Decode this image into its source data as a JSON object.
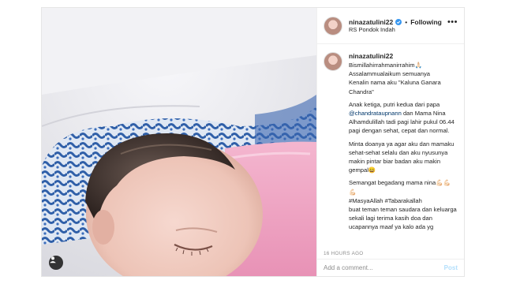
{
  "post": {
    "username": "ninazatulini22",
    "separator": "•",
    "follow_status": "Following",
    "location": "RS Pondok Indah",
    "more_icon": "more-horizontal-icon",
    "verified_icon": "verified-badge-icon"
  },
  "caption": {
    "username": "ninazatulini22",
    "lines": {
      "l1": "Bismillahirrahmanirrahim🙏🏻",
      "l2": "Assalammualaikum semuanya",
      "l3": "Kenalin nama aku \"Kaluna Ganara Chandra\"",
      "l4a": "Anak ketiga, putri kedua dari papa",
      "mention": "@chandrataupnann",
      "l4b": " dan Mama Nina Alhamdulillah tadi pagi lahir pukul 06.44 pagi dengan sehat, cepat dan normal.",
      "l5": "Minta doanya ya agar aku dan mamaku sehat-sehat selalu dan aku nyusunya makin pintar biar badan aku makin gempal😄",
      "l6": "Semangat begadang mama nina💪🏻💪🏻💪🏻",
      "l7": "#MasyaAllah #Tabarakallah",
      "l8": "buat teman teman saudara dan keluarga sekali lagi terima kasih doa dan ucapannya maaf ya kalo ada yg"
    }
  },
  "timestamp": "16 HOURS AGO",
  "comment": {
    "placeholder": "Add a comment...",
    "post_label": "Post"
  },
  "colors": {
    "link": "#00376b",
    "verified": "#3897f0",
    "post_disabled": "#b2dffc",
    "blanket_pink": "#f2a9c7"
  }
}
